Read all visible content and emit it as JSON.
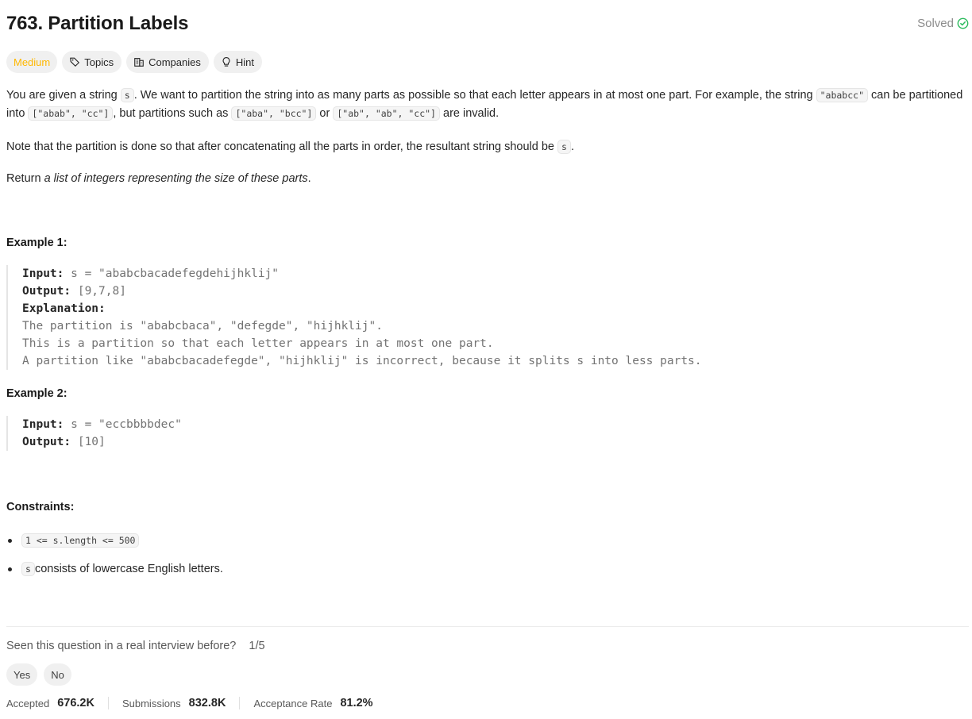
{
  "problem": {
    "title": "763. Partition Labels",
    "status": "Solved"
  },
  "tags": {
    "difficulty": "Medium",
    "topics": "Topics",
    "companies": "Companies",
    "hint": "Hint"
  },
  "description": {
    "p1_a": "You are given a string ",
    "p1_code_s": "s",
    "p1_b": ". We want to partition the string into as many parts as possible so that each letter appears in at most one part. For example, the string ",
    "p1_code_ex": "\"ababcc\"",
    "p1_c": " can be partitioned into ",
    "p1_code_p1": "[\"abab\", \"cc\"]",
    "p1_d": ", but partitions such as ",
    "p1_code_p2": "[\"aba\", \"bcc\"]",
    "p1_e": " or ",
    "p1_code_p3": "[\"ab\", \"ab\", \"cc\"]",
    "p1_f": " are invalid.",
    "p2_a": "Note that the partition is done so that after concatenating all the parts in order, the resultant string should be ",
    "p2_code": "s",
    "p2_b": ".",
    "p3_a": "Return ",
    "p3_em": "a list of integers representing the size of these parts",
    "p3_b": "."
  },
  "examples": [
    {
      "title": "Example 1:",
      "input_label": "Input:",
      "input": " s = \"ababcbacadefegdehijhklij\"",
      "output_label": "Output:",
      "output": " [9,7,8]",
      "explanation_label": "Explanation:",
      "explanation_lines": [
        "The partition is \"ababcbaca\", \"defegde\", \"hijhklij\".",
        "This is a partition so that each letter appears in at most one part.",
        "A partition like \"ababcbacadefegde\", \"hijhklij\" is incorrect, because it splits s into less parts."
      ]
    },
    {
      "title": "Example 2:",
      "input_label": "Input:",
      "input": " s = \"eccbbbbdec\"",
      "output_label": "Output:",
      "output": " [10]"
    }
  ],
  "constraints": {
    "title": "Constraints:",
    "c1_code": "1 <= s.length <= 500",
    "c2_code": "s",
    "c2_text": " consists of lowercase English letters."
  },
  "feedback": {
    "question": "Seen this question in a real interview before?",
    "count": "1/5",
    "yes": "Yes",
    "no": "No"
  },
  "stats": {
    "accepted_label": "Accepted",
    "accepted_value": "676.2K",
    "submissions_label": "Submissions",
    "submissions_value": "832.8K",
    "rate_label": "Acceptance Rate",
    "rate_value": "81.2%"
  },
  "colors": {
    "medium": "#ffb800",
    "solved_check": "#2cbb5d"
  },
  "icons": {
    "solved": "check-circle-icon",
    "topics": "tag-icon",
    "companies": "building-icon",
    "hint": "lightbulb-icon"
  }
}
